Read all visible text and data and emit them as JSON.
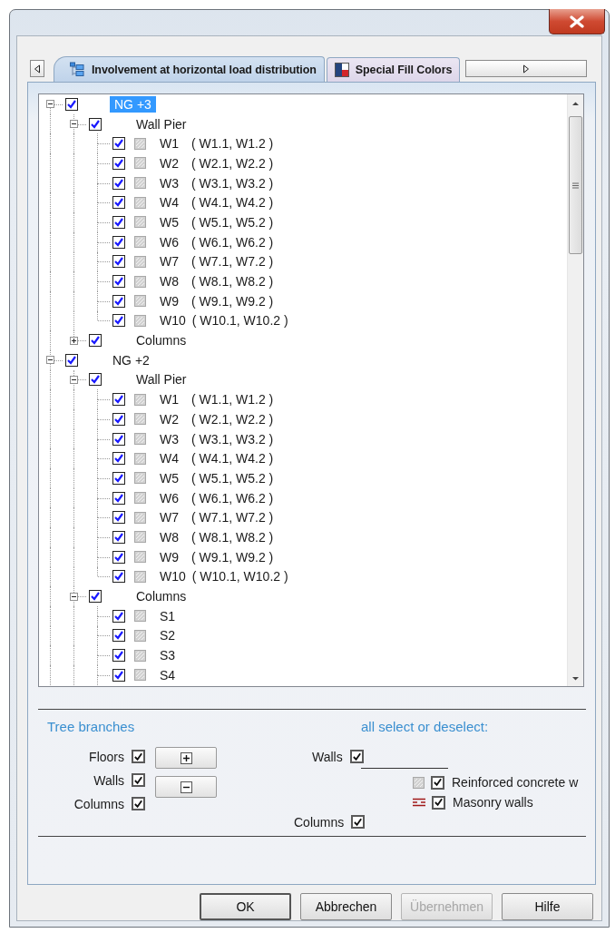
{
  "tabs": [
    {
      "label": "Involvement at horizontal load distribution",
      "selected": true,
      "kind": "tree"
    },
    {
      "label": "Special Fill Colors",
      "selected": false,
      "kind": "colors"
    }
  ],
  "tree": [
    {
      "label": "NG +3",
      "kind": "floor",
      "checked": true,
      "expanded": true,
      "selected": true,
      "children": [
        {
          "label": "Wall Pier",
          "kind": "group",
          "checked": true,
          "expanded": true,
          "selected": false,
          "children": [
            {
              "label": "W1",
              "detail": "( W1.1, W1.2 )",
              "kind": "element",
              "checked": true,
              "selected": false
            },
            {
              "label": "W2",
              "detail": "( W2.1, W2.2 )",
              "kind": "element",
              "checked": true,
              "selected": false
            },
            {
              "label": "W3",
              "detail": "( W3.1, W3.2 )",
              "kind": "element",
              "checked": true,
              "selected": false
            },
            {
              "label": "W4",
              "detail": "( W4.1, W4.2 )",
              "kind": "element",
              "checked": true,
              "selected": false
            },
            {
              "label": "W5",
              "detail": "( W5.1, W5.2 )",
              "kind": "element",
              "checked": true,
              "selected": false
            },
            {
              "label": "W6",
              "detail": "( W6.1, W6.2 )",
              "kind": "element",
              "checked": true,
              "selected": false
            },
            {
              "label": "W7",
              "detail": "( W7.1, W7.2 )",
              "kind": "element",
              "checked": true,
              "selected": false
            },
            {
              "label": "W8",
              "detail": "( W8.1, W8.2 )",
              "kind": "element",
              "checked": true,
              "selected": false
            },
            {
              "label": "W9",
              "detail": "( W9.1, W9.2 )",
              "kind": "element",
              "checked": true,
              "selected": false
            },
            {
              "label": "W10",
              "detail": "( W10.1, W10.2 )",
              "kind": "element",
              "checked": true,
              "selected": false
            }
          ]
        },
        {
          "label": "Columns",
          "kind": "group",
          "checked": true,
          "expanded": false,
          "selected": false
        }
      ]
    },
    {
      "label": "NG +2",
      "kind": "floor",
      "checked": true,
      "expanded": true,
      "selected": false,
      "children": [
        {
          "label": "Wall Pier",
          "kind": "group",
          "checked": true,
          "expanded": true,
          "selected": false,
          "children": [
            {
              "label": "W1",
              "detail": "( W1.1, W1.2 )",
              "kind": "element",
              "checked": true,
              "selected": false
            },
            {
              "label": "W2",
              "detail": "( W2.1, W2.2 )",
              "kind": "element",
              "checked": true,
              "selected": false
            },
            {
              "label": "W3",
              "detail": "( W3.1, W3.2 )",
              "kind": "element",
              "checked": true,
              "selected": false
            },
            {
              "label": "W4",
              "detail": "( W4.1, W4.2 )",
              "kind": "element",
              "checked": true,
              "selected": false
            },
            {
              "label": "W5",
              "detail": "( W5.1, W5.2 )",
              "kind": "element",
              "checked": true,
              "selected": false
            },
            {
              "label": "W6",
              "detail": "( W6.1, W6.2 )",
              "kind": "element",
              "checked": true,
              "selected": false
            },
            {
              "label": "W7",
              "detail": "( W7.1, W7.2 )",
              "kind": "element",
              "checked": true,
              "selected": false
            },
            {
              "label": "W8",
              "detail": "( W8.1, W8.2 )",
              "kind": "element",
              "checked": true,
              "selected": false
            },
            {
              "label": "W9",
              "detail": "( W9.1, W9.2 )",
              "kind": "element",
              "checked": true,
              "selected": false
            },
            {
              "label": "W10",
              "detail": "( W10.1, W10.2 )",
              "kind": "element",
              "checked": true,
              "selected": false
            }
          ]
        },
        {
          "label": "Columns",
          "kind": "group",
          "checked": true,
          "expanded": true,
          "selected": false,
          "children": [
            {
              "label": "S1",
              "kind": "element",
              "checked": true,
              "selected": false
            },
            {
              "label": "S2",
              "kind": "element",
              "checked": true,
              "selected": false
            },
            {
              "label": "S3",
              "kind": "element",
              "checked": true,
              "selected": false
            },
            {
              "label": "S4",
              "kind": "element",
              "checked": true,
              "selected": false
            }
          ]
        }
      ]
    }
  ],
  "tree_branches": {
    "title": "Tree branches",
    "options": [
      {
        "label": "Floors",
        "checked": true
      },
      {
        "label": "Walls",
        "checked": true
      },
      {
        "label": "Columns",
        "checked": true
      }
    ]
  },
  "select_all": {
    "title": "all select or deselect:",
    "walls": {
      "label": "Walls",
      "checked": true,
      "types": [
        {
          "label": "Reinforced concrete w",
          "checked": true,
          "kind": "concrete"
        },
        {
          "label": "Masonry walls",
          "checked": true,
          "kind": "masonry"
        }
      ]
    },
    "columns": {
      "label": "Columns",
      "checked": true
    }
  },
  "buttons": [
    {
      "label": "OK",
      "default": true,
      "disabled": false
    },
    {
      "label": "Abbrechen",
      "default": false,
      "disabled": false
    },
    {
      "label": "Übernehmen",
      "default": false,
      "disabled": true
    },
    {
      "label": "Hilfe",
      "default": false,
      "disabled": false
    }
  ]
}
